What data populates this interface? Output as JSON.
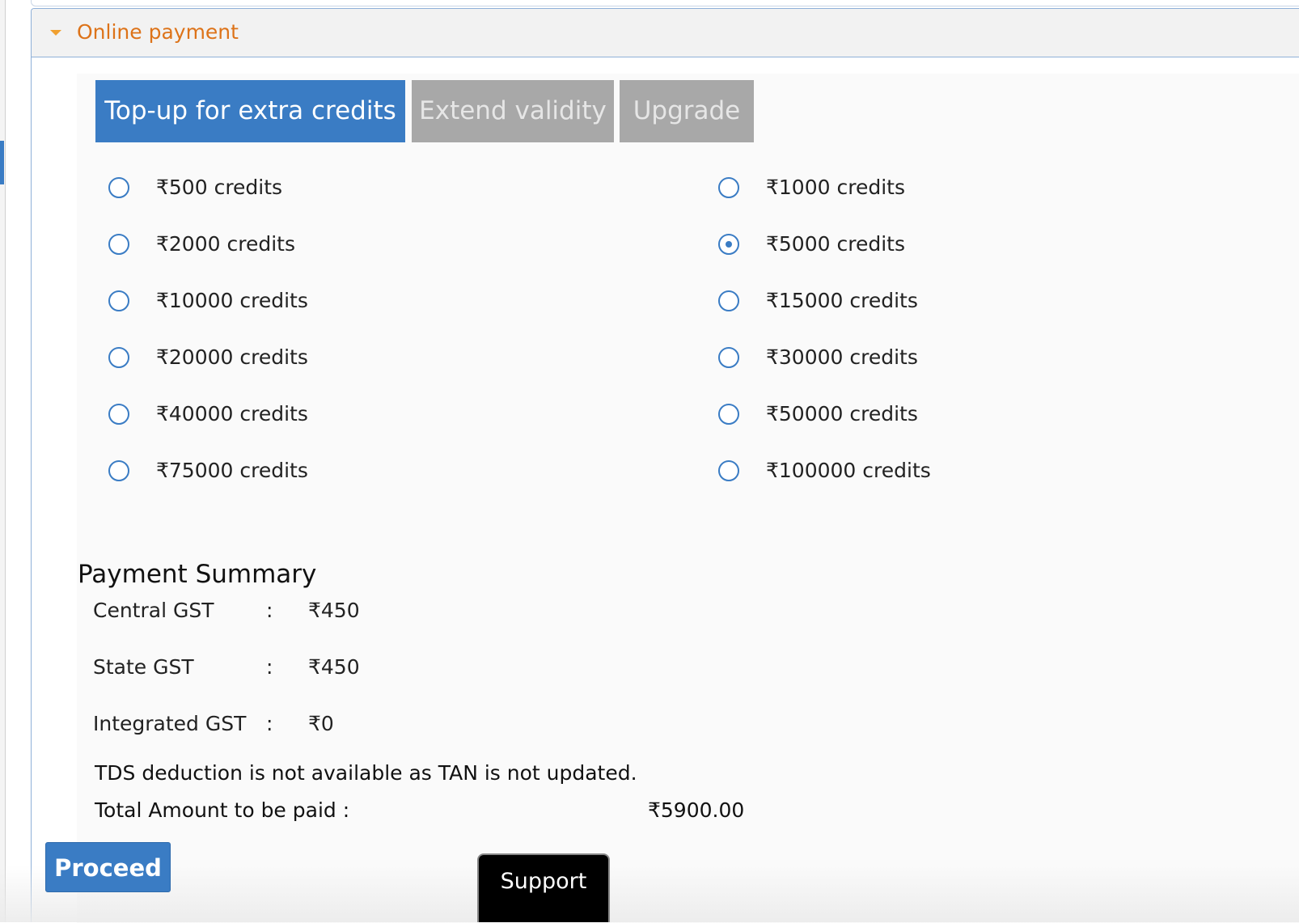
{
  "panel": {
    "title": "Online payment"
  },
  "tabs": [
    {
      "label": "Top-up for extra credits",
      "active": true
    },
    {
      "label": "Extend validity",
      "active": false
    },
    {
      "label": "Upgrade",
      "active": false
    }
  ],
  "credit_options": [
    {
      "label": "₹500 credits",
      "selected": false
    },
    {
      "label": "₹1000 credits",
      "selected": false
    },
    {
      "label": "₹2000 credits",
      "selected": false
    },
    {
      "label": "₹5000 credits",
      "selected": true
    },
    {
      "label": "₹10000 credits",
      "selected": false
    },
    {
      "label": "₹15000 credits",
      "selected": false
    },
    {
      "label": "₹20000 credits",
      "selected": false
    },
    {
      "label": "₹30000 credits",
      "selected": false
    },
    {
      "label": "₹40000 credits",
      "selected": false
    },
    {
      "label": "₹50000 credits",
      "selected": false
    },
    {
      "label": "₹75000 credits",
      "selected": false
    },
    {
      "label": "₹100000 credits",
      "selected": false
    }
  ],
  "summary": {
    "title": "Payment Summary",
    "separator": ":",
    "rows": [
      {
        "label": "Central GST",
        "value": "₹450"
      },
      {
        "label": "State GST",
        "value": "₹450"
      },
      {
        "label": "Integrated GST",
        "value": "₹0"
      }
    ],
    "tds_note": "TDS deduction is not available as TAN is not updated.",
    "total_label": "Total Amount to be paid :",
    "total_value": "₹5900.00"
  },
  "actions": {
    "proceed_label": "Proceed",
    "support_label": "Support"
  },
  "colors": {
    "accent": "#3a7cc4",
    "header_text": "#dd7319",
    "inactive_tab": "#a8a8a8"
  }
}
